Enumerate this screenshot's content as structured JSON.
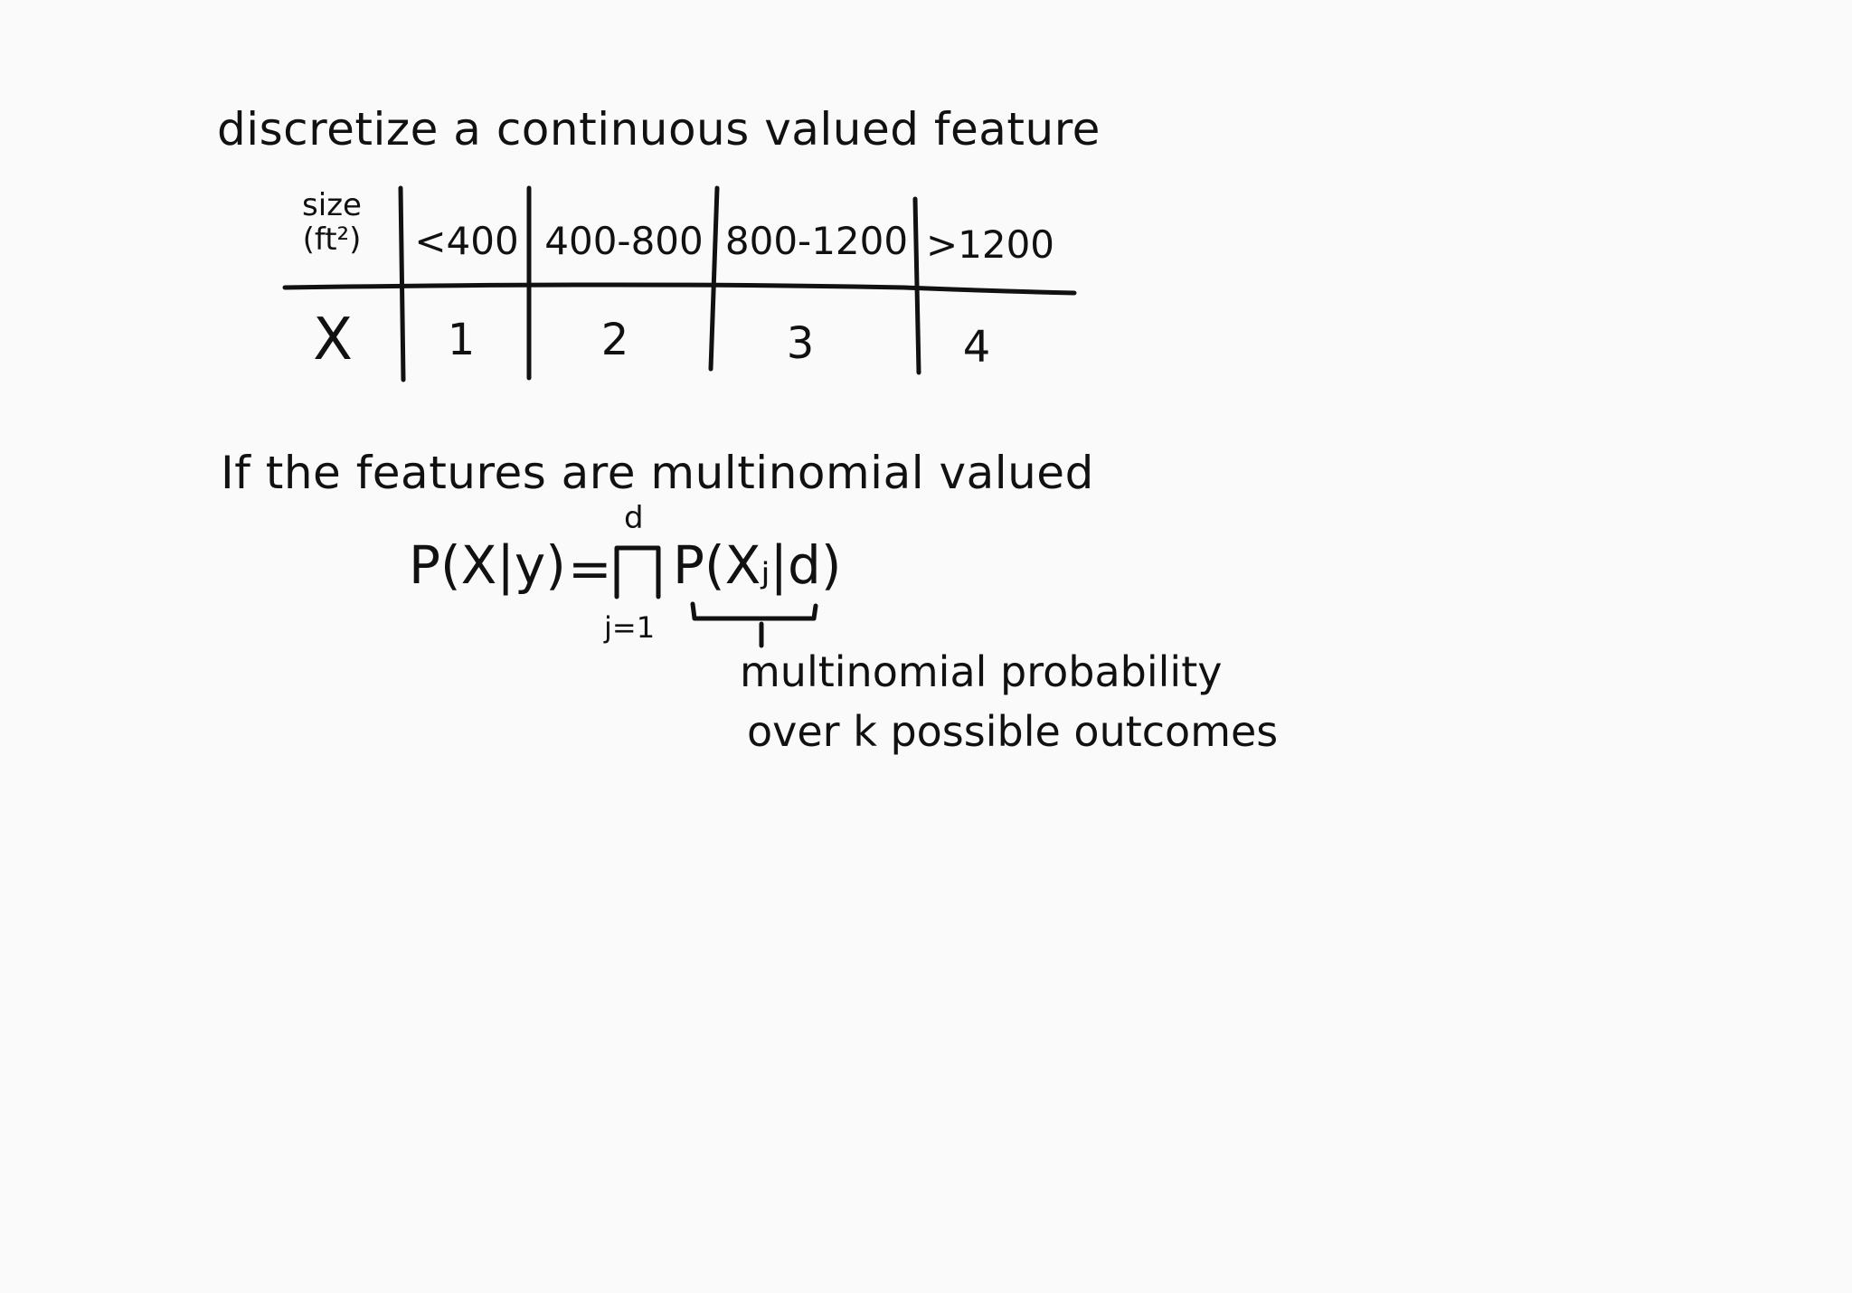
{
  "heading": "discretize a continuous valued feature",
  "table": {
    "header_label_line1": "size",
    "header_label_line2": "(ft²)",
    "bins": [
      "<400",
      "400-800",
      "800-1200",
      ">1200"
    ],
    "row_label": "X",
    "values": [
      "1",
      "2",
      "3",
      "4"
    ]
  },
  "section2_heading": "If the features are multinomial valued",
  "equation": {
    "lhs": "P(X|y)",
    "equals": "=",
    "product_upper": "d",
    "product_lower": "j=1",
    "rhs": "P(Xⱼ|d)"
  },
  "annotation": {
    "line1": "multinomial probability",
    "line2": "over k possible outcomes"
  }
}
